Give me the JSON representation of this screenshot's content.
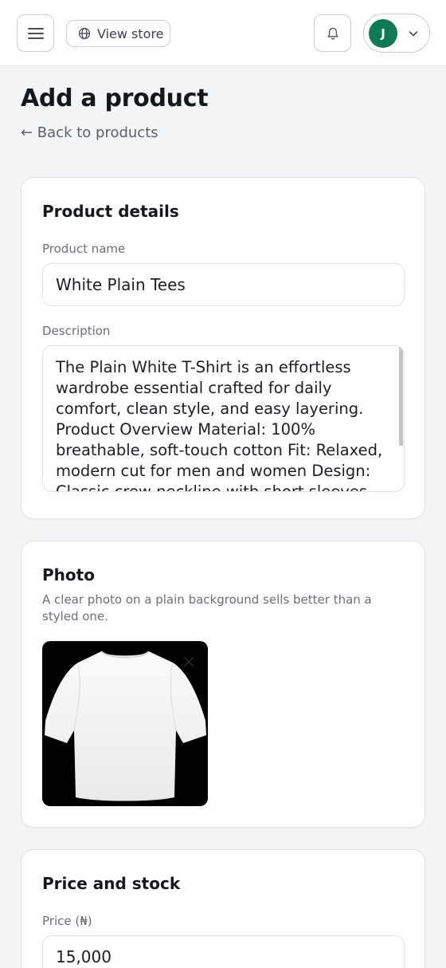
{
  "header": {
    "view_store_label": "View store",
    "avatar_initial": "J",
    "accent_color": "#0e7a55"
  },
  "page": {
    "title": "Add a product",
    "back_link": "← Back to products"
  },
  "product_details": {
    "title": "Product details",
    "name_label": "Product name",
    "name_value": "White Plain Tees",
    "description_label": "Description",
    "description_value": "The Plain White T-Shirt is an effortless wardrobe essential crafted for daily comfort, clean style, and easy layering. Product Overview Material: 100% breathable, soft-touch cotton Fit: Relaxed, modern cut for men and women Design: Classic crew neckline with short sleeves"
  },
  "photo": {
    "title": "Photo",
    "help_text": "A clear photo on a plain background sells better than a styled one.",
    "image_alt": "White t-shirt"
  },
  "price_stock": {
    "title": "Price and stock",
    "price_label": "Price (₦)",
    "price_value": "15,000"
  },
  "icons": [
    "hamburger-menu-icon",
    "globe-icon",
    "bell-icon",
    "chevron-down-icon",
    "close-icon",
    "tshirt-image"
  ]
}
